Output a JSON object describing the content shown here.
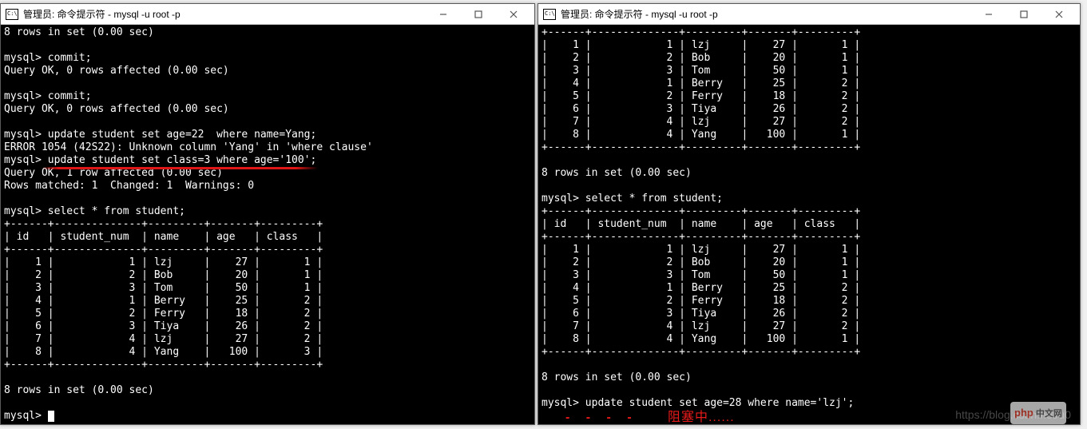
{
  "fragment_top": "",
  "title_left": "管理员: 命令提示符 - mysql  -u root -p",
  "title_right": "管理员: 命令提示符 - mysql  -u root -p",
  "prompt": "mysql>",
  "left": {
    "rows_in_set": "8 rows in set (0.00 sec)",
    "commit_cmd": "commit;",
    "commit_ok": "Query OK, 0 rows affected (0.00 sec)",
    "update1_cmd": "update student set age=22  where name=Yang;",
    "update1_err": "ERROR 1054 (42S22): Unknown column 'Yang' in 'where clause'",
    "update2_cmd": "update student set class=3 where age='100';",
    "update2_ok": "Query OK, 1 row affected (0.00 sec)",
    "update2_match": "Rows matched: 1  Changed: 1  Warnings: 0",
    "select_cmd": "select * from student;",
    "headers": [
      "id",
      "student_num",
      "name",
      "age",
      "class"
    ],
    "rows": [
      [
        "1",
        "1",
        "lzj",
        "27",
        "1"
      ],
      [
        "2",
        "2",
        "Bob",
        "20",
        "1"
      ],
      [
        "3",
        "3",
        "Tom",
        "50",
        "1"
      ],
      [
        "4",
        "1",
        "Berry",
        "25",
        "2"
      ],
      [
        "5",
        "2",
        "Ferry",
        "18",
        "2"
      ],
      [
        "6",
        "3",
        "Tiya",
        "26",
        "2"
      ],
      [
        "7",
        "4",
        "lzj",
        "27",
        "2"
      ],
      [
        "8",
        "4",
        "Yang",
        "100",
        "3"
      ]
    ],
    "footer": "8 rows in set (0.00 sec)"
  },
  "right": {
    "top_rows": [
      [
        "1",
        "1",
        "lzj",
        "27",
        "1"
      ],
      [
        "2",
        "2",
        "Bob",
        "20",
        "1"
      ],
      [
        "3",
        "3",
        "Tom",
        "50",
        "1"
      ],
      [
        "4",
        "1",
        "Berry",
        "25",
        "2"
      ],
      [
        "5",
        "2",
        "Ferry",
        "18",
        "2"
      ],
      [
        "6",
        "3",
        "Tiya",
        "26",
        "2"
      ],
      [
        "7",
        "4",
        "lzj",
        "27",
        "2"
      ],
      [
        "8",
        "4",
        "Yang",
        "100",
        "1"
      ]
    ],
    "rows_in_set": "8 rows in set (0.00 sec)",
    "select_cmd": "select * from student;",
    "headers": [
      "id",
      "student_num",
      "name",
      "age",
      "class"
    ],
    "rows2": [
      [
        "1",
        "1",
        "lzj",
        "27",
        "1"
      ],
      [
        "2",
        "2",
        "Bob",
        "20",
        "1"
      ],
      [
        "3",
        "3",
        "Tom",
        "50",
        "1"
      ],
      [
        "4",
        "1",
        "Berry",
        "25",
        "2"
      ],
      [
        "5",
        "2",
        "Ferry",
        "18",
        "2"
      ],
      [
        "6",
        "3",
        "Tiya",
        "26",
        "2"
      ],
      [
        "7",
        "4",
        "lzj",
        "27",
        "2"
      ],
      [
        "8",
        "4",
        "Yang",
        "100",
        "1"
      ]
    ],
    "footer": "8 rows in set (0.00 sec)",
    "update_cmd": "update student set age=28 where name='lzj';",
    "annotation": "阻塞中......"
  },
  "watermark": "https://blog.csdn.net/u0",
  "badge": "php 中文网"
}
